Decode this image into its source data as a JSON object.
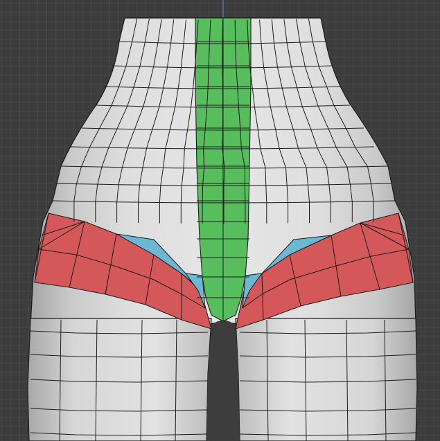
{
  "viewport": {
    "mode": "edit-mode-mesh",
    "background_color": "#3d3d3d",
    "grid_color": "#474747",
    "y_axis_color": "#4a80c8"
  },
  "mesh": {
    "object": "hips-and-legs",
    "base_color": "#dcdcdc",
    "shadow_color": "#a9a9a9",
    "wire_color": "#1b1b1b",
    "face_groups": [
      {
        "name": "center-strip",
        "color": "#58bd5d"
      },
      {
        "name": "hip-band",
        "color": "#d4585a"
      },
      {
        "name": "groin-triangles",
        "color": "#6cb7d1"
      }
    ]
  }
}
